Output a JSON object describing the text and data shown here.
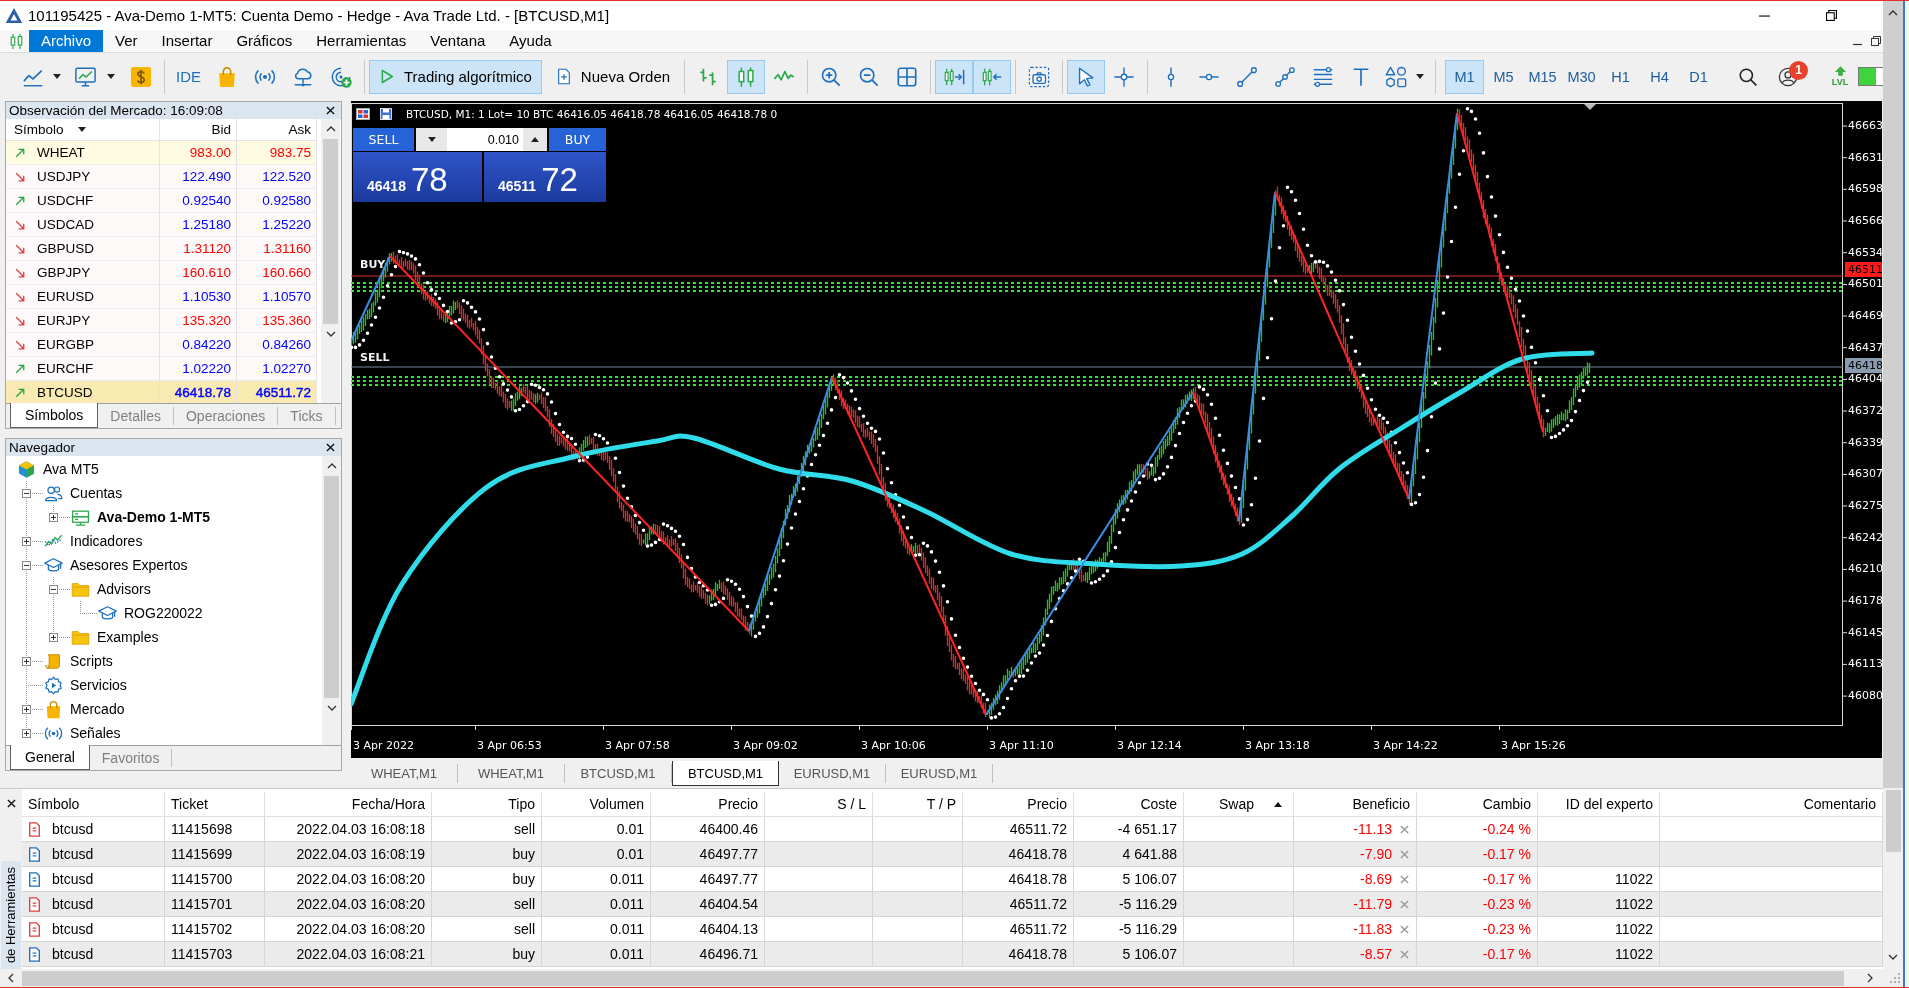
{
  "window": {
    "title": "101195425 - Ava-Demo 1-MT5: Cuenta Demo - Hedge - Ava Trade Ltd. - [BTCUSD,M1]"
  },
  "menu": [
    {
      "label": "Archivo",
      "selected": true
    },
    {
      "label": "Ver",
      "selected": false
    },
    {
      "label": "Insertar",
      "selected": false
    },
    {
      "label": "Gráficos",
      "selected": false
    },
    {
      "label": "Herramientas",
      "selected": false
    },
    {
      "label": "Ventana",
      "selected": false
    },
    {
      "label": "Ayuda",
      "selected": false
    }
  ],
  "toolbar": {
    "groups": [
      [
        {
          "kind": "chart",
          "selected": false,
          "dropdown": true
        },
        {
          "kind": "indicators",
          "selected": false,
          "dropdown": true
        },
        {
          "kind": "deposit",
          "selected": false,
          "dropdown": false
        }
      ],
      [
        {
          "kind": "ide",
          "label": "IDE",
          "selected": false,
          "dropdown": false
        },
        {
          "kind": "market",
          "selected": false,
          "dropdown": false
        },
        {
          "kind": "signals",
          "selected": false,
          "dropdown": false
        },
        {
          "kind": "cloud",
          "selected": false,
          "dropdown": false
        },
        {
          "kind": "radar",
          "selected": false,
          "dropdown": false
        }
      ],
      [
        {
          "kind": "algo",
          "label": "Trading algorítmico",
          "selected": true,
          "dropdown": false
        },
        {
          "kind": "order",
          "label": "Nueva Orden",
          "selected": false,
          "dropdown": false
        }
      ],
      [
        {
          "kind": "bars",
          "selected": false,
          "dropdown": false
        },
        {
          "kind": "candles",
          "selected": true,
          "dropdown": false
        },
        {
          "kind": "line",
          "selected": false,
          "dropdown": false
        }
      ],
      [
        {
          "kind": "zoomin",
          "selected": false,
          "dropdown": false
        },
        {
          "kind": "zoomout",
          "selected": false,
          "dropdown": false
        },
        {
          "kind": "tile",
          "selected": false,
          "dropdown": false
        }
      ],
      [
        {
          "kind": "autoscroll",
          "selected": true,
          "dropdown": false
        },
        {
          "kind": "shift",
          "selected": true,
          "dropdown": false
        }
      ],
      [
        {
          "kind": "screenshot",
          "selected": false,
          "dropdown": false
        }
      ],
      [
        {
          "kind": "cursor",
          "selected": true,
          "dropdown": false
        },
        {
          "kind": "crosshair",
          "selected": false,
          "dropdown": false
        }
      ],
      [
        {
          "kind": "vline",
          "selected": false,
          "dropdown": false
        },
        {
          "kind": "hline",
          "selected": false,
          "dropdown": false
        },
        {
          "kind": "trend",
          "selected": false,
          "dropdown": false
        },
        {
          "kind": "channel",
          "selected": false,
          "dropdown": false
        },
        {
          "kind": "levels",
          "selected": false,
          "dropdown": false
        },
        {
          "kind": "text",
          "selected": false,
          "dropdown": false
        },
        {
          "kind": "shapes",
          "selected": false,
          "dropdown": true
        }
      ]
    ],
    "timeframes": [
      {
        "label": "M1",
        "selected": true
      },
      {
        "label": "M5",
        "selected": false
      },
      {
        "label": "M15",
        "selected": false
      },
      {
        "label": "M30",
        "selected": false
      },
      {
        "label": "H1",
        "selected": false
      },
      {
        "label": "H4",
        "selected": false
      },
      {
        "label": "D1",
        "selected": false
      }
    ],
    "account_badge": "1",
    "level_label": "LVL"
  },
  "market_watch": {
    "title": "Observación del Mercado: 16:09:08",
    "columns": [
      "Símbolo",
      "Bid",
      "Ask"
    ],
    "rows": [
      {
        "symbol": "WHEAT",
        "bid": "983.00",
        "ask": "983.75",
        "rising": true,
        "color": "#ff0000",
        "selected": true,
        "highlighted": false
      },
      {
        "symbol": "USDJPY",
        "bid": "122.490",
        "ask": "122.520",
        "rising": false,
        "color": "#0000ff",
        "selected": false,
        "highlighted": false
      },
      {
        "symbol": "USDCHF",
        "bid": "0.92540",
        "ask": "0.92580",
        "rising": true,
        "color": "#0000ff",
        "selected": false,
        "highlighted": false
      },
      {
        "symbol": "USDCAD",
        "bid": "1.25180",
        "ask": "1.25220",
        "rising": false,
        "color": "#0000ff",
        "selected": false,
        "highlighted": false
      },
      {
        "symbol": "GBPUSD",
        "bid": "1.31120",
        "ask": "1.31160",
        "rising": false,
        "color": "#ff0000",
        "selected": false,
        "highlighted": false
      },
      {
        "symbol": "GBPJPY",
        "bid": "160.610",
        "ask": "160.660",
        "rising": false,
        "color": "#ff0000",
        "selected": false,
        "highlighted": false
      },
      {
        "symbol": "EURUSD",
        "bid": "1.10530",
        "ask": "1.10570",
        "rising": false,
        "color": "#0000ff",
        "selected": false,
        "highlighted": false
      },
      {
        "symbol": "EURJPY",
        "bid": "135.320",
        "ask": "135.360",
        "rising": false,
        "color": "#ff0000",
        "selected": false,
        "highlighted": false
      },
      {
        "symbol": "EURGBP",
        "bid": "0.84220",
        "ask": "0.84260",
        "rising": false,
        "color": "#0000ff",
        "selected": false,
        "highlighted": false
      },
      {
        "symbol": "EURCHF",
        "bid": "1.02220",
        "ask": "1.02270",
        "rising": true,
        "color": "#0000ff",
        "selected": false,
        "highlighted": false
      },
      {
        "symbol": "BTCUSD",
        "bid": "46418.78",
        "ask": "46511.72",
        "rising": true,
        "color": "#0000ff",
        "selected": false,
        "highlighted": true
      }
    ],
    "tabs": [
      {
        "label": "Símbolos",
        "selected": true
      },
      {
        "label": "Detalles",
        "selected": false
      },
      {
        "label": "Operaciones",
        "selected": false
      },
      {
        "label": "Ticks",
        "selected": false
      }
    ]
  },
  "navigator": {
    "title": "Navegador",
    "tree": [
      {
        "label": "Ava MT5",
        "kind": "broker",
        "children": [
          {
            "label": "Cuentas",
            "kind": "accounts",
            "expanded": true,
            "children": [
              {
                "label": "Ava-Demo 1-MT5",
                "kind": "account",
                "expanded": false
              }
            ]
          },
          {
            "label": "Indicadores",
            "kind": "indicators",
            "expanded": false
          },
          {
            "label": "Asesores Expertos",
            "kind": "experts",
            "expanded": true,
            "children": [
              {
                "label": "Advisors",
                "kind": "folder",
                "expanded": true,
                "children": [
                  {
                    "label": "ROG220022",
                    "kind": "expert"
                  }
                ]
              },
              {
                "label": "Examples",
                "kind": "folder",
                "expanded": false
              }
            ]
          },
          {
            "label": "Scripts",
            "kind": "scripts",
            "expanded": false
          },
          {
            "label": "Servicios",
            "kind": "services"
          },
          {
            "label": "Mercado",
            "kind": "market",
            "expanded": false
          },
          {
            "label": "Señales",
            "kind": "signals",
            "expanded": false
          }
        ]
      }
    ],
    "tabs": [
      {
        "label": "General",
        "selected": true
      },
      {
        "label": "Favoritos",
        "selected": false
      }
    ]
  },
  "chart": {
    "header": "BTCUSD, M1: 1 Lot= 10 BTC 46416.05 46418.78 46416.05 46418.78 0",
    "trade_panel": {
      "sell_label": "SELL",
      "buy_label": "BUY",
      "volume": "0.010",
      "sell_price": "46418",
      "sell_pips": "78",
      "buy_price": "46511",
      "buy_pips": "72"
    },
    "trade_labels": [
      "BUY",
      "SELL"
    ],
    "price_ticks": [
      "46663",
      "46631",
      "46598",
      "46566",
      "46534",
      "46501",
      "46469",
      "46437",
      "46404",
      "46372",
      "46339",
      "46307",
      "46275",
      "46242",
      "46210",
      "46178",
      "46145",
      "46113",
      "46080"
    ],
    "ask_label": "46511",
    "bid_label": "46418",
    "time_ticks": [
      "3 Apr 2022",
      "3 Apr 06:53",
      "3 Apr 07:58",
      "3 Apr 09:02",
      "3 Apr 10:06",
      "3 Apr 11:10",
      "3 Apr 12:14",
      "3 Apr 13:18",
      "3 Apr 14:22",
      "3 Apr 15:26"
    ]
  },
  "chart_tabs": [
    {
      "label": "WHEAT,M1",
      "selected": false
    },
    {
      "label": "WHEAT,M1",
      "selected": false
    },
    {
      "label": "BTCUSD,M1",
      "selected": false
    },
    {
      "label": "BTCUSD,M1",
      "selected": true
    },
    {
      "label": "EURUSD,M1",
      "selected": false
    },
    {
      "label": "EURUSD,M1",
      "selected": false
    }
  ],
  "toolbox": {
    "side_title": "de Herramientas",
    "columns": [
      {
        "label": "Símbolo",
        "sorted": false
      },
      {
        "label": "Ticket",
        "sorted": false
      },
      {
        "label": "Fecha/Hora",
        "sorted": false
      },
      {
        "label": "Tipo",
        "sorted": false
      },
      {
        "label": "Volumen",
        "sorted": false
      },
      {
        "label": "Precio",
        "sorted": false
      },
      {
        "label": "S / L",
        "sorted": false
      },
      {
        "label": "T / P",
        "sorted": false
      },
      {
        "label": "Precio",
        "sorted": false
      },
      {
        "label": "Coste",
        "sorted": false
      },
      {
        "label": "Swap",
        "sorted": true
      },
      {
        "label": "Beneficio",
        "sorted": false
      },
      {
        "label": "Cambio",
        "sorted": false
      },
      {
        "label": "ID del experto",
        "sorted": false
      },
      {
        "label": "Comentario",
        "sorted": false
      }
    ],
    "rows": [
      {
        "kind": "sell",
        "symbol": "btcusd",
        "ticket": "11415698",
        "time": "2022.04.03 16:08:18",
        "type": "sell",
        "volume": "0.01",
        "price": "46400.46",
        "current_price": "46511.72",
        "cost": "-4 651.17",
        "profit": "-11.13",
        "change": "-0.24 %"
      },
      {
        "kind": "buy",
        "symbol": "btcusd",
        "ticket": "11415699",
        "time": "2022.04.03 16:08:19",
        "type": "buy",
        "volume": "0.01",
        "price": "46497.77",
        "current_price": "46418.78",
        "cost": "4 641.88",
        "profit": "-7.90",
        "change": "-0.17 %"
      },
      {
        "kind": "buy",
        "symbol": "btcusd",
        "ticket": "11415700",
        "time": "2022.04.03 16:08:20",
        "type": "buy",
        "volume": "0.011",
        "price": "46497.77",
        "current_price": "46418.78",
        "cost": "5 106.07",
        "profit": "-8.69",
        "change": "-0.17 %",
        "expert_id": "11022"
      },
      {
        "kind": "sell",
        "symbol": "btcusd",
        "ticket": "11415701",
        "time": "2022.04.03 16:08:20",
        "type": "sell",
        "volume": "0.011",
        "price": "46404.54",
        "current_price": "46511.72",
        "cost": "-5 116.29",
        "profit": "-11.79",
        "change": "-0.23 %",
        "expert_id": "11022"
      },
      {
        "kind": "sell",
        "symbol": "btcusd",
        "ticket": "11415702",
        "time": "2022.04.03 16:08:20",
        "type": "sell",
        "volume": "0.011",
        "price": "46404.13",
        "current_price": "46511.72",
        "cost": "-5 116.29",
        "profit": "-11.83",
        "change": "-0.23 %",
        "expert_id": "11022"
      },
      {
        "kind": "buy",
        "symbol": "btcusd",
        "ticket": "11415703",
        "time": "2022.04.03 16:08:21",
        "type": "buy",
        "volume": "0.011",
        "price": "46496.71",
        "current_price": "46418.78",
        "cost": "5 106.07",
        "profit": "-8.57",
        "change": "-0.17 %",
        "expert_id": "11022"
      }
    ]
  }
}
